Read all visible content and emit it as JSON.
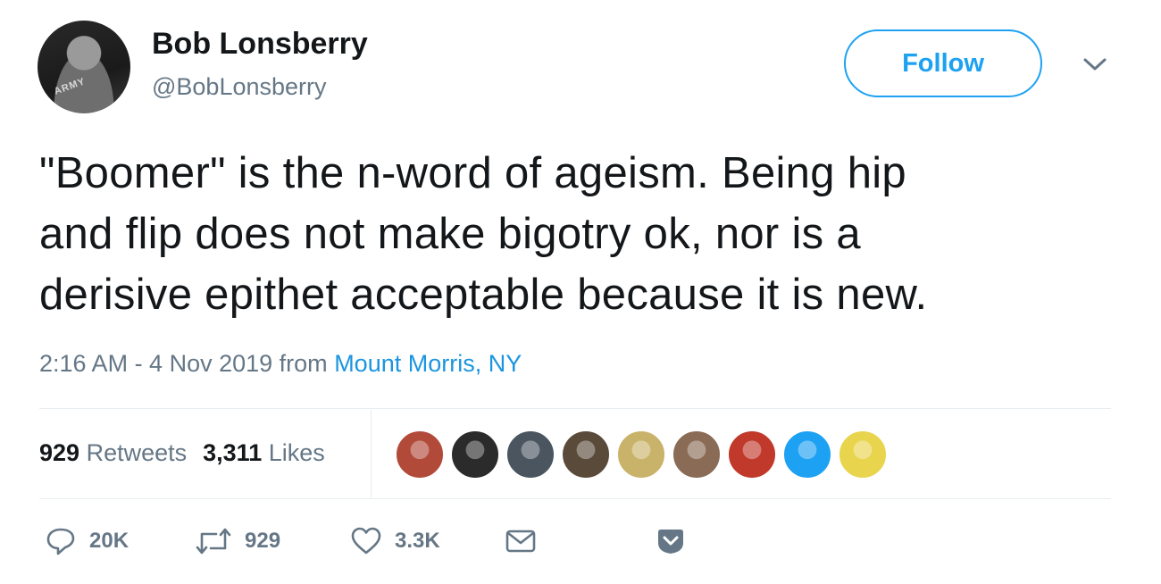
{
  "user": {
    "name": "Bob Lonsberry",
    "handle": "@BobLonsberry",
    "avatar_shirt_text": "ARMY"
  },
  "follow_label": "Follow",
  "tweet": {
    "line1": "\"Boomer\" is the n-word of ageism. Being hip",
    "line2": "and flip does not make bigotry ok, nor is a",
    "line3": "derisive epithet acceptable because it is new."
  },
  "meta": {
    "time": "2:16 AM - 4 Nov 2019",
    "from": "from",
    "location": "Mount Morris, NY"
  },
  "stats": {
    "retweets_count": "929",
    "retweets_label": "Retweets",
    "likes_count": "3,311",
    "likes_label": "Likes"
  },
  "likers": [
    {
      "name": "liker-avatar-1",
      "color": "#b24a3a"
    },
    {
      "name": "liker-avatar-2",
      "color": "#2b2b2b"
    },
    {
      "name": "liker-avatar-3",
      "color": "#4a5560"
    },
    {
      "name": "liker-avatar-4",
      "color": "#5a4a3a"
    },
    {
      "name": "liker-avatar-5",
      "color": "#c9b36a"
    },
    {
      "name": "liker-avatar-6",
      "color": "#8a6b55"
    },
    {
      "name": "liker-avatar-7",
      "color": "#c0392b"
    },
    {
      "name": "liker-avatar-8",
      "color": "#1da1f2"
    },
    {
      "name": "liker-avatar-9",
      "color": "#e8d44d"
    }
  ],
  "actions": {
    "reply_count": "20K",
    "retweet_count": "929",
    "like_count": "3.3K"
  },
  "colors": {
    "accent": "#1da1f2",
    "link": "#1b95e0",
    "secondary_text": "#657786",
    "primary_text": "#14171a",
    "divider": "#e6ecf0"
  },
  "icons": [
    "reply-icon",
    "retweet-icon",
    "heart-icon",
    "envelope-icon",
    "caret-down-icon"
  ]
}
